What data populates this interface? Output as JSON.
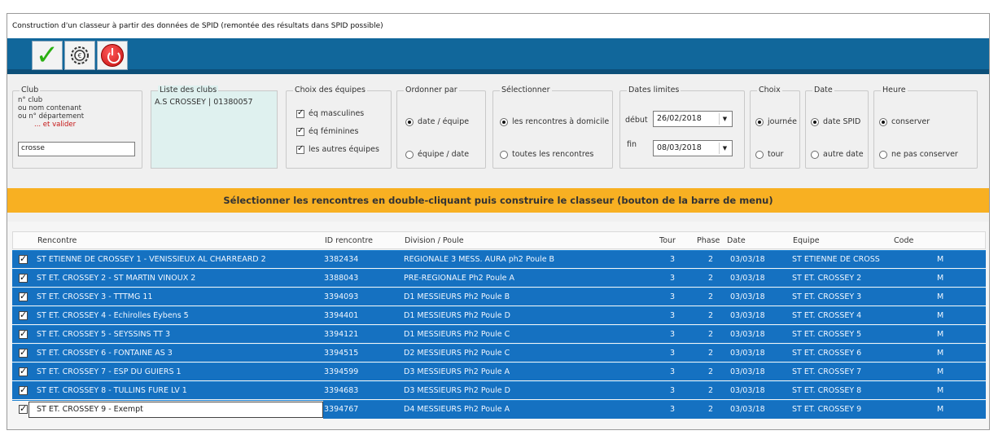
{
  "title": "Construction d'un classeur à partir des données de SPID (remontée des résultats dans SPID possible)",
  "toolbar": {
    "buttons": [
      {
        "name": "validate",
        "icon": "checkmark-icon"
      },
      {
        "name": "settings",
        "icon": "gear-icon"
      },
      {
        "name": "exit",
        "icon": "power-icon"
      }
    ]
  },
  "club_box": {
    "legend": "Club",
    "line1": "n° club",
    "line2": "ou nom contenant",
    "line3": "ou n° département",
    "line4": "... et valider",
    "input_value": "crosse"
  },
  "club_list": {
    "legend": "Liste des clubs",
    "items": [
      "A.S CROSSEY | 01380057"
    ]
  },
  "teams_choice": {
    "legend": "Choix des équipes",
    "options": [
      {
        "label": "éq masculines",
        "checked": true
      },
      {
        "label": "éq féminines",
        "checked": true
      },
      {
        "label": "les autres équipes",
        "checked": true
      }
    ]
  },
  "order_by": {
    "legend": "Ordonner par",
    "options": [
      {
        "label": "date / équipe",
        "selected": true
      },
      {
        "label": "équipe / date",
        "selected": false
      }
    ]
  },
  "select": {
    "legend": "Sélectionner",
    "options": [
      {
        "label": "les rencontres à domicile",
        "selected": true
      },
      {
        "label": "toutes les rencontres",
        "selected": false
      }
    ]
  },
  "date_limits": {
    "legend": "Dates limites",
    "start_label": "début",
    "start_value": "26/02/2018",
    "end_label": "fin",
    "end_value": "08/03/2018"
  },
  "choice": {
    "legend": "Choix",
    "options": [
      {
        "label": "journée",
        "selected": true
      },
      {
        "label": "tour",
        "selected": false
      }
    ]
  },
  "date": {
    "legend": "Date",
    "options": [
      {
        "label": "date SPID",
        "selected": true
      },
      {
        "label": "autre date",
        "selected": false
      }
    ]
  },
  "hour": {
    "legend": "Heure",
    "options": [
      {
        "label": "conserver",
        "selected": true
      },
      {
        "label": "ne pas conserver",
        "selected": false
      }
    ]
  },
  "banner": "Sélectionner les rencontres en double-cliquant puis construire le classeur (bouton de la barre de menu)",
  "table": {
    "columns": [
      "Rencontre",
      "ID rencontre",
      "Division / Poule",
      "Tour",
      "Phase",
      "Date",
      "Equipe",
      "Code"
    ],
    "rows": [
      [
        "ST ETIENNE DE CROSSEY 1 - VENISSIEUX AL CHARREARD 2",
        "3382434",
        "REGIONALE 3 MESS. AURA ph2 Poule B",
        "3",
        "2",
        "03/03/18",
        "ST ETIENNE DE CROSS",
        "M"
      ],
      [
        "ST ET. CROSSEY 2 - ST MARTIN VINOUX 2",
        "3388043",
        "PRE-REGIONALE Ph2 Poule A",
        "3",
        "2",
        "03/03/18",
        "ST ET. CROSSEY 2",
        "M"
      ],
      [
        "ST ET. CROSSEY 3 - TTTMG 11",
        "3394093",
        "D1 MESSIEURS Ph2 Poule B",
        "3",
        "2",
        "03/03/18",
        "ST ET. CROSSEY 3",
        "M"
      ],
      [
        "ST ET. CROSSEY 4 - Echirolles Eybens 5",
        "3394401",
        "D1 MESSIEURS Ph2 Poule D",
        "3",
        "2",
        "03/03/18",
        "ST ET. CROSSEY 4",
        "M"
      ],
      [
        "ST ET. CROSSEY 5 - SEYSSINS TT 3",
        "3394121",
        "D1 MESSIEURS Ph2 Poule C",
        "3",
        "2",
        "03/03/18",
        "ST ET. CROSSEY 5",
        "M"
      ],
      [
        "ST ET. CROSSEY 6 - FONTAINE AS 3",
        "3394515",
        "D2 MESSIEURS Ph2 Poule C",
        "3",
        "2",
        "03/03/18",
        "ST ET. CROSSEY 6",
        "M"
      ],
      [
        "ST ET. CROSSEY 7 - ESP DU GUIERS 1",
        "3394599",
        "D3 MESSIEURS Ph2 Poule A",
        "3",
        "2",
        "03/03/18",
        "ST ET. CROSSEY 7",
        "M"
      ],
      [
        "ST ET. CROSSEY 8 - TULLINS FURE LV 1",
        "3394683",
        "D3 MESSIEURS Ph2 Poule D",
        "3",
        "2",
        "03/03/18",
        "ST ET. CROSSEY 8",
        "M"
      ],
      [
        "ST ET. CROSSEY 9 - Exempt",
        "3394767",
        "D4 MESSIEURS Ph2 Poule A",
        "3",
        "2",
        "03/03/18",
        "ST ET. CROSSEY 9",
        "M"
      ]
    ]
  },
  "colors": {
    "toolbar": "#11679b",
    "banner": "#f8b022",
    "row_selected": "#1571c1",
    "club_list_bg": "#dff1ef"
  }
}
